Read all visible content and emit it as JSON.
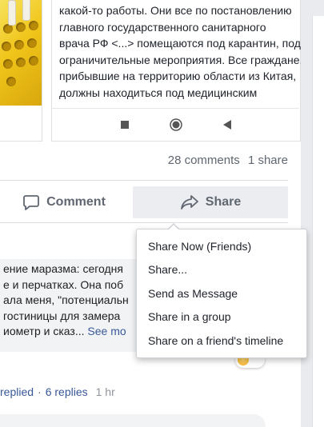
{
  "link_preview": {
    "excerpt_lines": [
      "какой-то работы. Они все по постановлению",
      "главного государственного санитарного",
      "врача РФ <...> помещаются под карантин, под",
      "ограничительные мероприятия. Все граждане,",
      "прибывшие на территорию области из Китая,",
      "должны находиться под медицинским"
    ],
    "image_icon": "test-tubes-image",
    "nav_icons": [
      "stop-icon",
      "record-icon",
      "back-icon"
    ]
  },
  "stats": {
    "comments": "28 comments",
    "shares": "1 share"
  },
  "actions": {
    "comment_label": "Comment",
    "share_label": "Share"
  },
  "comment": {
    "lines": [
      "ение маразма: сегодня",
      "е и перчатках. Она поб",
      "ала меня, \"потенциальн",
      "гостиницы для замера",
      "иометр и сказ..."
    ],
    "see_more": "See mo"
  },
  "reply_row": {
    "replied": "replied",
    "replies": "6 replies",
    "time": "1 hr"
  },
  "share_menu": {
    "items": [
      "Share Now (Friends)",
      "Share...",
      "Send as Message",
      "Share in a group",
      "Share on a friend's timeline"
    ]
  },
  "colors": {
    "link": "#385898",
    "muted": "#606770",
    "menu_border": "#cfd2d6",
    "share_bg": "#ebedf0"
  }
}
